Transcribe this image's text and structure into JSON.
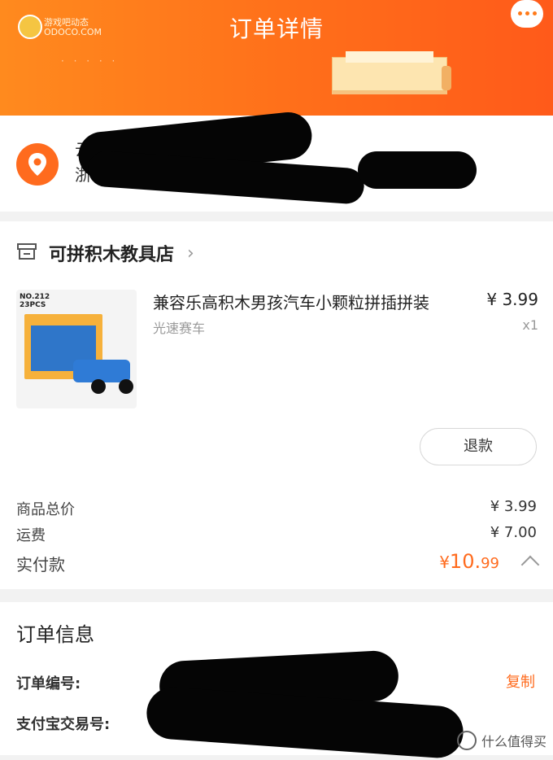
{
  "header": {
    "title": "订单详情",
    "logo_text_line1": "游戏吧动态",
    "logo_text_line2": "ODOCO.COM",
    "more_icon": "ellipsis-icon"
  },
  "address": {
    "visible_text": "云",
    "visible_text_2": "浙",
    "icon": "location-pin-icon"
  },
  "shop": {
    "name": "可拼积木教具店",
    "icon": "store-icon"
  },
  "product": {
    "thumb_label_1": "NO.212",
    "thumb_label_2": "23PCS",
    "name": "兼容乐高积木男孩汽车小颗粒拼插拼装",
    "spec": "光速赛车",
    "price": "¥ 3.99",
    "qty": "x1"
  },
  "actions": {
    "refund_label": "退款"
  },
  "summary": {
    "goods_total_label": "商品总价",
    "goods_total_value": "¥ 3.99",
    "shipping_label": "运费",
    "shipping_value": "¥ 7.00",
    "paid_label": "实付款",
    "paid_currency": "¥",
    "paid_int": "10.",
    "paid_dec": "99"
  },
  "order_info": {
    "title": "订单信息",
    "order_no_label": "订单编号:",
    "alipay_label": "支付宝交易号:",
    "copy_label": "复制"
  },
  "watermark": {
    "text": "什么值得买"
  },
  "colors": {
    "accent": "#ff6b1e",
    "header_start": "#ff8a1e",
    "header_end": "#ff5a1a"
  }
}
